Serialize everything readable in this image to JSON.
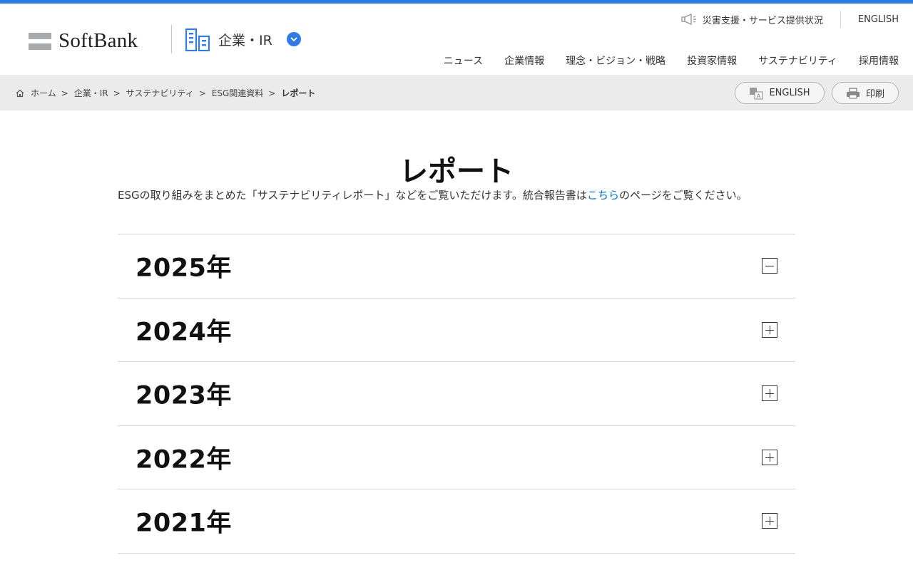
{
  "brand": {
    "name": "SoftBank",
    "accent": "#2f7ae5"
  },
  "header": {
    "section_label": "企業・IR",
    "utility": {
      "disaster_link": "災害支援・サービス提供状況",
      "english": "ENGLISH"
    },
    "gnav": [
      "ニュース",
      "企業情報",
      "理念・ビジョン・戦略",
      "投資家情報",
      "サステナビリティ",
      "採用情報"
    ]
  },
  "breadcrumb": {
    "items": [
      "ホーム",
      "企業・IR",
      "サステナビリティ",
      "ESG関連資料"
    ],
    "current": "レポート",
    "separator": ">"
  },
  "actions": {
    "english": "ENGLISH",
    "print": "印刷"
  },
  "main": {
    "title": "レポート",
    "lead_before": "ESGの取り組みをまとめた「サステナビリティレポート」などをご覧いただけます。統合報告書は",
    "lead_link": "こちら",
    "lead_after": "のページをご覧ください。",
    "years": [
      {
        "label": "2025年",
        "expanded": true
      },
      {
        "label": "2024年",
        "expanded": false
      },
      {
        "label": "2023年",
        "expanded": false
      },
      {
        "label": "2022年",
        "expanded": false
      },
      {
        "label": "2021年",
        "expanded": false
      }
    ]
  }
}
